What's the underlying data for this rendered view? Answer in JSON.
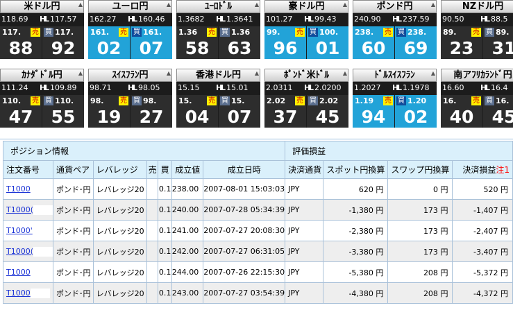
{
  "tiles": [
    {
      "name": "米ドル円",
      "high": "118.69",
      "low": "117.57",
      "sell_small": "117.",
      "buy_small": "117.",
      "sell_big": "88",
      "buy_big": "92",
      "blue": false
    },
    {
      "name": "ユーロ円",
      "high": "162.27",
      "low": "160.46",
      "sell_small": "161.",
      "buy_small": "161.",
      "sell_big": "02",
      "buy_big": "07",
      "blue": true
    },
    {
      "name": "ﾕｰﾛﾄﾞﾙ",
      "high": "1.3682",
      "low": "1.3641",
      "sell_small": "1.36",
      "buy_small": "1.36",
      "sell_big": "58",
      "buy_big": "63",
      "blue": false
    },
    {
      "name": "豪ドル円",
      "high": "101.27",
      "low": "99.43",
      "sell_small": "99.",
      "buy_small": "100.",
      "sell_big": "96",
      "buy_big": "01",
      "blue": true
    },
    {
      "name": "ポンド円",
      "high": "240.90",
      "low": "237.59",
      "sell_small": "238.",
      "buy_small": "238.",
      "sell_big": "60",
      "buy_big": "69",
      "blue": true
    },
    {
      "name": "NZドル円",
      "high": "90.50",
      "low": "88.5",
      "sell_small": "89.",
      "buy_small": "89.",
      "sell_big": "23",
      "buy_big": "31",
      "blue": false
    },
    {
      "name": "ｶﾅﾀﾞﾄﾞﾙ円",
      "high": "111.24",
      "low": "109.89",
      "sell_small": "110.",
      "buy_small": "110.",
      "sell_big": "47",
      "buy_big": "55",
      "blue": false
    },
    {
      "name": "ｽｲｽﾌﾗﾝ円",
      "high": "98.71",
      "low": "98.05",
      "sell_small": "98.",
      "buy_small": "98.",
      "sell_big": "19",
      "buy_big": "27",
      "blue": false
    },
    {
      "name": "香港ドル円",
      "high": "15.15",
      "low": "15.01",
      "sell_small": "15.",
      "buy_small": "15.",
      "sell_big": "04",
      "buy_big": "07",
      "blue": false
    },
    {
      "name": "ﾎﾟﾝﾄﾞ米ﾄﾞﾙ",
      "high": "2.0311",
      "low": "2.0200",
      "sell_small": "2.02",
      "buy_small": "2.02",
      "sell_big": "37",
      "buy_big": "45",
      "blue": false
    },
    {
      "name": "ﾄﾞﾙｽｲｽﾌﾗﾝ",
      "high": "1.2027",
      "low": "1.1978",
      "sell_small": "1.19",
      "buy_small": "1.20",
      "sell_big": "94",
      "buy_big": "02",
      "blue": true
    },
    {
      "name": "南アﾌﾘｶﾗﾝﾄﾞ円",
      "high": "16.60",
      "low": "16.4",
      "sell_small": "16.",
      "buy_small": "16.",
      "sell_big": "40",
      "buy_big": "45",
      "blue": false
    }
  ],
  "labels": {
    "high": "H",
    "low": "L",
    "sell": "売",
    "buy": "買"
  },
  "positions": {
    "section_left": "ポジション情報",
    "section_right": "評価損益",
    "headers": {
      "order_no": "注文番号",
      "pair": "通貨ペア",
      "leverage": "レバレッジ",
      "sell": "売",
      "buy": "買",
      "price": "成立値",
      "date": "成立日時",
      "currency": "決済通貨",
      "spot": "スポット円換算",
      "swap": "スワップ円換算",
      "pnl": "決済損益",
      "note": "注1"
    },
    "unit": "円",
    "rows": [
      {
        "order": "T1000",
        "pair": "ポンド･円",
        "leverage": "レバレッジ20",
        "sell": "",
        "buy": "0.1",
        "price": "238.00",
        "date": "2007-08-01 15:03:03",
        "currency": "JPY",
        "spot": "620",
        "spot_neg": false,
        "swap": "0",
        "pnl": "520",
        "pnl_neg": false
      },
      {
        "order": "T1000(",
        "pair": "ポンド･円",
        "leverage": "レバレッジ20",
        "sell": "",
        "buy": "0.1",
        "price": "240.00",
        "date": "2007-07-28 05:34:39",
        "currency": "JPY",
        "spot": "-1,380",
        "spot_neg": true,
        "swap": "173",
        "pnl": "-1,407",
        "pnl_neg": true
      },
      {
        "order": "T1000'",
        "pair": "ポンド･円",
        "leverage": "レバレッジ20",
        "sell": "",
        "buy": "0.1",
        "price": "241.00",
        "date": "2007-07-27 20:08:30",
        "currency": "JPY",
        "spot": "-2,380",
        "spot_neg": true,
        "swap": "173",
        "pnl": "-2,407",
        "pnl_neg": true
      },
      {
        "order": "T1000(",
        "pair": "ポンド･円",
        "leverage": "レバレッジ20",
        "sell": "",
        "buy": "0.1",
        "price": "242.00",
        "date": "2007-07-27 06:31:05",
        "currency": "JPY",
        "spot": "-3,380",
        "spot_neg": true,
        "swap": "173",
        "pnl": "-3,407",
        "pnl_neg": true
      },
      {
        "order": "T1000",
        "pair": "ポンド･円",
        "leverage": "レバレッジ20",
        "sell": "",
        "buy": "0.1",
        "price": "244.00",
        "date": "2007-07-26 22:15:30",
        "currency": "JPY",
        "spot": "-5,380",
        "spot_neg": true,
        "swap": "208",
        "pnl": "-5,372",
        "pnl_neg": true
      },
      {
        "order": "T1000",
        "pair": "ポンド･円",
        "leverage": "レバレッジ20",
        "sell": "",
        "buy": "0.1",
        "price": "243.00",
        "date": "2007-07-27 03:54:39",
        "currency": "JPY",
        "spot": "-4,380",
        "spot_neg": true,
        "swap": "208",
        "pnl": "-4,372",
        "pnl_neg": true
      }
    ]
  }
}
